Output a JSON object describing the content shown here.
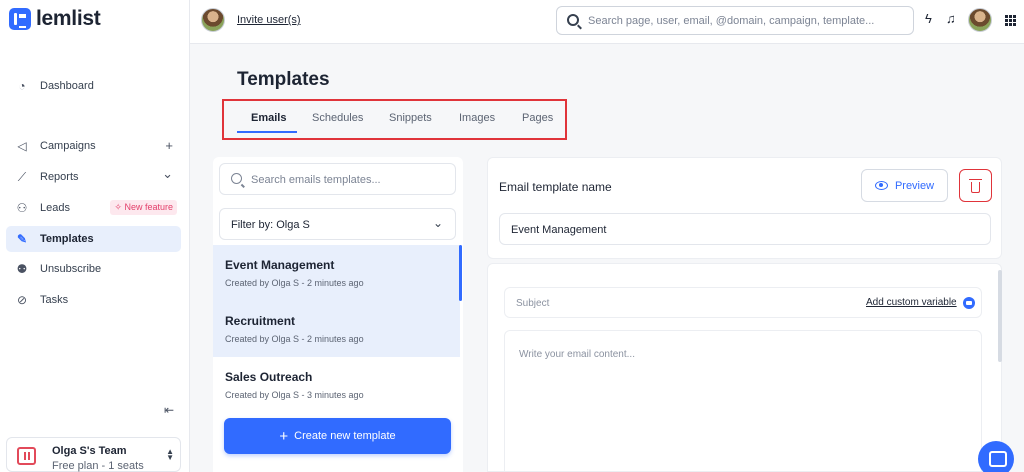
{
  "brand": {
    "name": "lemlist",
    "accent": "#316bff",
    "danger": "#e0343a"
  },
  "sidebar": {
    "items": [
      {
        "label": "Dashboard",
        "icon": "gauge-icon"
      },
      {
        "label": "Campaigns",
        "icon": "megaphone-icon",
        "trail": "+"
      },
      {
        "label": "Reports",
        "icon": "chart-line-icon",
        "trail": "⌄"
      },
      {
        "label": "Leads",
        "icon": "people-icon",
        "badge": "New feature"
      },
      {
        "label": "Templates",
        "icon": "magic-wand-icon",
        "active": true
      },
      {
        "label": "Unsubscribe",
        "icon": "user-x-icon"
      },
      {
        "label": "Tasks",
        "icon": "check-circle-icon"
      }
    ],
    "collapse_glyph": "⇤",
    "team": {
      "name": "Olga S's Team",
      "plan": "Free plan - 1 seats"
    }
  },
  "topbar": {
    "invite_label": "Invite user(s)",
    "search_placeholder": "Search page, user, email, @domain, campaign, template..."
  },
  "main": {
    "title": "Templates",
    "tabs": [
      {
        "label": "Emails",
        "active": true
      },
      {
        "label": "Schedules"
      },
      {
        "label": "Snippets"
      },
      {
        "label": "Images"
      },
      {
        "label": "Pages"
      }
    ]
  },
  "templates_panel": {
    "search_placeholder": "Search emails templates...",
    "filter_label": "Filter by: Olga S",
    "items": [
      {
        "name": "Event Management",
        "meta": "Created by Olga S - 2 minutes ago",
        "selected": true
      },
      {
        "name": "Recruitment",
        "meta": "Created by Olga S - 2 minutes ago",
        "selected": true
      },
      {
        "name": "Sales Outreach",
        "meta": "Created by Olga S - 3 minutes ago"
      }
    ],
    "create_label": "Create new template"
  },
  "editor": {
    "name_label": "Email template name",
    "preview_label": "Preview",
    "name_value": "Event Management",
    "subject_placeholder": "Subject",
    "custom_variable_label": "Add custom variable",
    "content_placeholder": "Write your email content..."
  }
}
